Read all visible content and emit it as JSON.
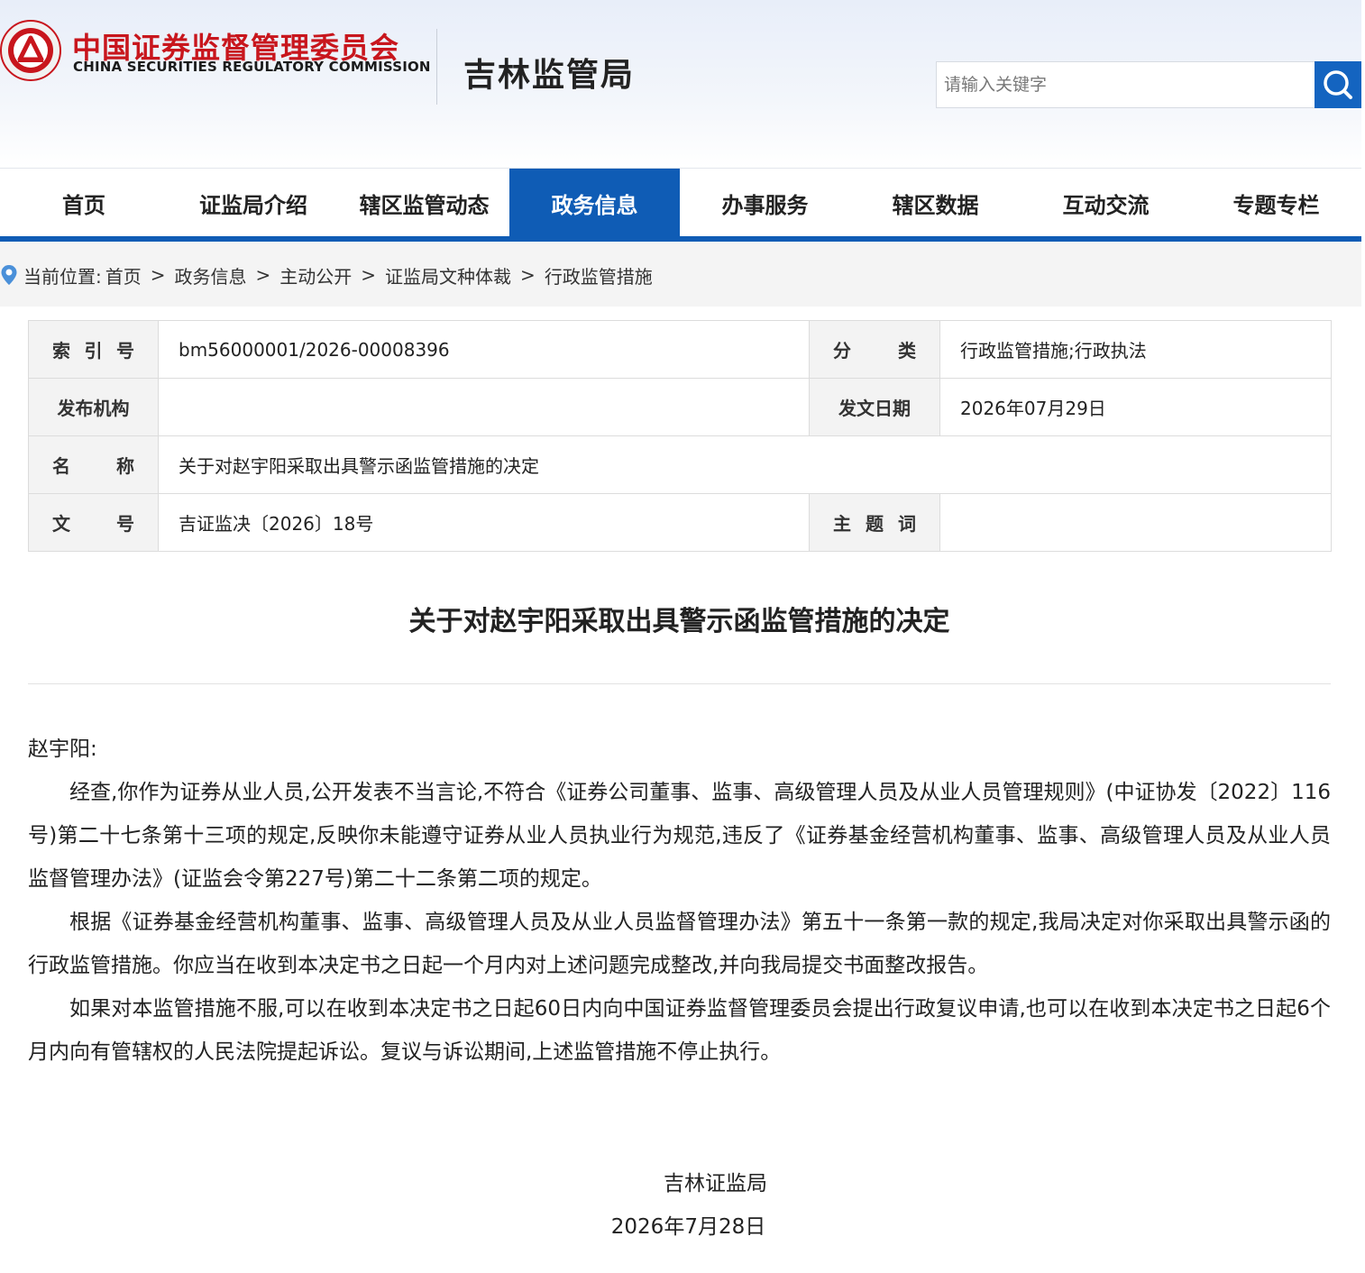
{
  "header": {
    "org_cn": "中国证券监督管理委员会",
    "org_en": "CHINA SECURITIES REGULATORY COMMISSION",
    "bureau": "吉林监管局",
    "search_placeholder": "请输入关键字",
    "search_icon": "search-icon",
    "brand_color": "#c8161d",
    "accent_color": "#0f5cb5"
  },
  "nav": {
    "items": [
      {
        "label": "首页"
      },
      {
        "label": "证监局介绍"
      },
      {
        "label": "辖区监管动态"
      },
      {
        "label": "政务信息"
      },
      {
        "label": "办事服务"
      },
      {
        "label": "辖区数据"
      },
      {
        "label": "互动交流"
      },
      {
        "label": "专题专栏"
      }
    ],
    "active": "政务信息"
  },
  "breadcrumb": {
    "prefix": "当前位置:",
    "items": [
      "首页",
      "政务信息",
      "主动公开",
      "证监局文种体裁",
      "行政监管措施"
    ]
  },
  "info": {
    "index_label": [
      "索",
      "引",
      "号"
    ],
    "index_value": "bm56000001/2026-00008396",
    "category_label": [
      "分",
      "类"
    ],
    "category_value": "行政监管措施;行政执法",
    "issuer_label": "发布机构",
    "issuer_value": "",
    "date_label": "发文日期",
    "date_value": "2026年07月29日",
    "name_label": [
      "名",
      "称"
    ],
    "name_value": "关于对赵宇阳采取出具警示函监管措施的决定",
    "docno_label": [
      "文",
      "号"
    ],
    "docno_value": "吉证监决〔2026〕18号",
    "keyword_label": [
      "主",
      "题",
      "词"
    ],
    "keyword_value": ""
  },
  "article": {
    "title": "关于对赵宇阳采取出具警示函监管措施的决定",
    "salutation": "赵宇阳:",
    "paragraphs": [
      "经查,你作为证券从业人员,公开发表不当言论,不符合《证券公司董事、监事、高级管理人员及从业人员管理规则》(中证协发〔2022〕116号)第二十七条第十三项的规定,反映你未能遵守证券从业人员执业行为规范,违反了《证券基金经营机构董事、监事、高级管理人员及从业人员监督管理办法》(证监会令第227号)第二十二条第二项的规定。",
      "根据《证券基金经营机构董事、监事、高级管理人员及从业人员监督管理办法》第五十一条第一款的规定,我局决定对你采取出具警示函的行政监管措施。你应当在收到本决定书之日起一个月内对上述问题完成整改,并向我局提交书面整改报告。",
      "如果对本监管措施不服,可以在收到本决定书之日起60日内向中国证券监督管理委员会提出行政复议申请,也可以在收到本决定书之日起6个月内向有管辖权的人民法院提起诉讼。复议与诉讼期间,上述监管措施不停止执行。"
    ],
    "sign_org": "吉林证监局",
    "sign_date": "2026年7月28日"
  }
}
